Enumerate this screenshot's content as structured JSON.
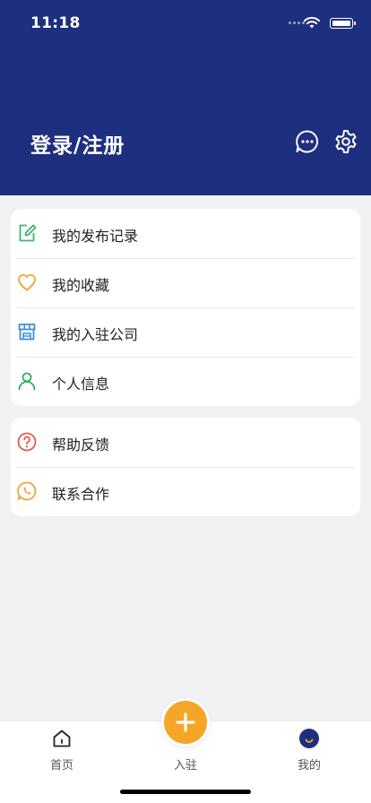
{
  "status_bar": {
    "time": "11:18"
  },
  "header": {
    "login_label": "登录/注册"
  },
  "menu_group_1": [
    {
      "label": "我的发布记录",
      "icon": "edit-icon",
      "color": "#3bb86a"
    },
    {
      "label": "我的收藏",
      "icon": "heart-icon",
      "color": "#f0a43a"
    },
    {
      "label": "我的入驻公司",
      "icon": "store-icon",
      "color": "#3a8fd8"
    },
    {
      "label": "个人信息",
      "icon": "user-icon",
      "color": "#2fae5e"
    }
  ],
  "menu_group_2": [
    {
      "label": "帮助反馈",
      "icon": "help-icon",
      "color": "#e2584b"
    },
    {
      "label": "联系合作",
      "icon": "phone-icon",
      "color": "#f0a43a"
    }
  ],
  "tabbar": {
    "home_label": "首页",
    "join_label": "入驻",
    "mine_label": "我的"
  },
  "colors": {
    "header_bg": "#1f2f7f",
    "accent": "#f5a626",
    "page_bg": "#f2f2f4"
  }
}
